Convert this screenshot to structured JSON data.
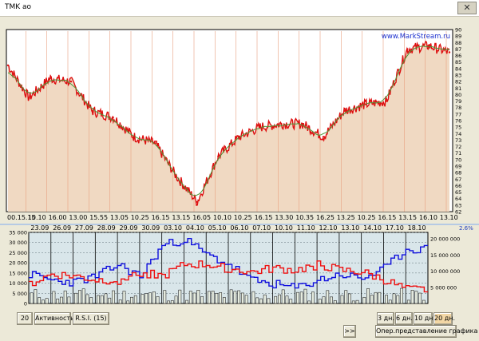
{
  "window": {
    "title": "TMK ao",
    "close_glyph": "✕"
  },
  "watermark": "www.MarkStream.ru",
  "colors": {
    "price_fill": "#f0d9c2",
    "price_line": "#dd1010",
    "ma_line": "#4a9a3a",
    "bg": "#ffffff",
    "vol_bg": "#d9e6ea",
    "blue": "#1010dd",
    "red": "#ee1010",
    "bars": "#2b2b2b",
    "vline": "#e8a080",
    "pct": "#1f3fbf"
  },
  "upper_x_labels": [
    "00.15.15",
    "10.10",
    "16.00",
    "13.00",
    "15.55",
    "13.05",
    "10.25",
    "16.15",
    "13.15",
    "16.05",
    "10.10",
    "10.25",
    "16.15",
    "13.30",
    "10.35",
    "16.25",
    "13.25",
    "10.25",
    "16.15",
    "13.15",
    "16.10",
    "13.10"
  ],
  "upper_y_labels": [
    "90",
    "89",
    "88",
    "87",
    "86",
    "85",
    "84",
    "83",
    "82",
    "81",
    "80",
    "79",
    "78",
    "77",
    "76",
    "75",
    "74",
    "73",
    "72",
    "71",
    "70",
    "69",
    "68",
    "67",
    "66",
    "65",
    "64",
    "63",
    "62"
  ],
  "percent_label": "2.6%",
  "lower_date_labels": [
    "23.09",
    "26.09",
    "27.09",
    "28.09",
    "29.09",
    "30.09",
    "03.10",
    "04.10",
    "05.10",
    "06.10",
    "07.10",
    "10.10",
    "11.10",
    "12.10",
    "13.10",
    "14.10",
    "17.10",
    "18.10"
  ],
  "lower_left_y": [
    "35 000",
    "30 000",
    "25 000",
    "20 000",
    "15 000",
    "10 000",
    "5 000",
    "0"
  ],
  "lower_right_y": [
    "20 000 000",
    "15 000 000",
    "10 000 000",
    "5 000 000"
  ],
  "buttons": {
    "period": "20",
    "activity": "Активность",
    "rsi": "R.S.I. (15)",
    "d3": "3 дн.",
    "d6": "6 дн.",
    "d10": "10 дн.",
    "d20": "20 дн.",
    "next": ">>",
    "oper": "Опер.представление графика"
  },
  "chart_data": [
    {
      "type": "area",
      "ylim": [
        62,
        90
      ],
      "categories": [
        "00.15.15",
        "10.10",
        "16.00",
        "13.00",
        "15.55",
        "13.05",
        "10.25",
        "16.15",
        "13.15",
        "16.05",
        "10.10",
        "10.25",
        "16.15",
        "13.30",
        "10.35",
        "16.25",
        "13.25",
        "10.25",
        "16.15",
        "13.15",
        "16.10",
        "13.10"
      ],
      "values": [
        84.5,
        79.5,
        82.5,
        82.0,
        77.5,
        76.5,
        73.5,
        72.5,
        67.5,
        63.5,
        70.5,
        73.5,
        75.0,
        75.5,
        75.5,
        73.5,
        77.5,
        78.5,
        79.0,
        87.0,
        87.5,
        86.5
      ]
    },
    {
      "type": "line",
      "categories": [
        "23.09",
        "26.09",
        "27.09",
        "28.09",
        "29.09",
        "30.09",
        "03.10",
        "04.10",
        "05.10",
        "06.10",
        "07.10",
        "10.10",
        "11.10",
        "12.10",
        "13.10",
        "14.10",
        "17.10",
        "18.10"
      ],
      "series": [
        {
          "values": [
            15000,
            12000,
            11000,
            14000,
            20000,
            14000,
            30000,
            33000,
            25000,
            20000,
            12000,
            10000,
            8000,
            12000,
            15000,
            13000,
            18000,
            28000
          ]
        },
        {
          "values": [
            10000,
            15000,
            14000,
            12000,
            12000,
            16000,
            14000,
            20000,
            20000,
            18000,
            16000,
            18000,
            17000,
            20000,
            17000,
            16000,
            12000,
            7000
          ]
        }
      ]
    }
  ]
}
